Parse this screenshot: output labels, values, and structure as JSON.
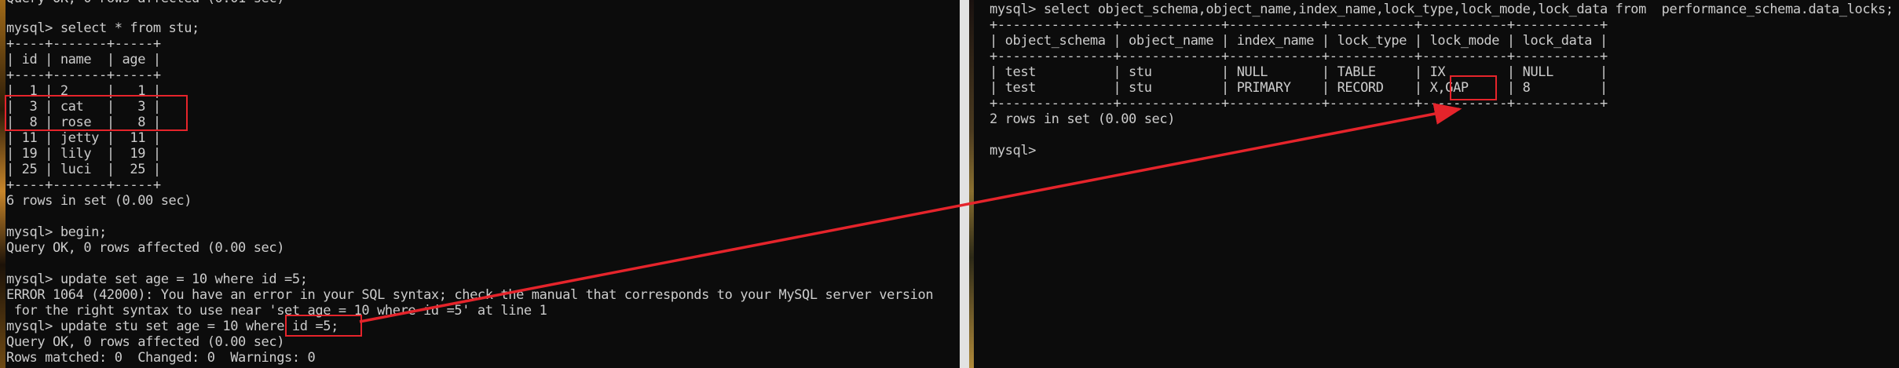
{
  "left_terminal": {
    "lines": [
      "Query OK, 0 rows affected (0.01 sec)",
      "",
      "mysql> select * from stu;",
      "+----+-------+-----+",
      "| id | name  | age |",
      "+----+-------+-----+",
      "|  1 | 2     |   1 |",
      "|  3 | cat   |   3 |",
      "|  8 | rose  |   8 |",
      "| 11 | jetty |  11 |",
      "| 19 | lily  |  19 |",
      "| 25 | luci  |  25 |",
      "+----+-------+-----+",
      "6 rows in set (0.00 sec)",
      "",
      "mysql> begin;",
      "Query OK, 0 rows affected (0.00 sec)",
      "",
      "mysql> update set age = 10 where id =5;",
      "ERROR 1064 (42000): You have an error in your SQL syntax; check the manual that corresponds to your MySQL server version",
      " for the right syntax to use near 'set age = 10 where id =5' at line 1",
      "mysql> update stu set age = 10 where id =5;",
      "Query OK, 0 rows affected (0.00 sec)",
      "Rows matched: 0  Changed: 0  Warnings: 0"
    ]
  },
  "right_terminal": {
    "lines": [
      "mysql> select object_schema,object_name,index_name,lock_type,lock_mode,lock_data from  performance_schema.data_locks;",
      "+---------------+-------------+------------+-----------+-----------+-----------+",
      "| object_schema | object_name | index_name | lock_type | lock_mode | lock_data |",
      "+---------------+-------------+------------+-----------+-----------+-----------+",
      "| test          | stu         | NULL       | TABLE     | IX        | NULL      |",
      "| test          | stu         | PRIMARY    | RECORD    | X,GAP     | 8         |",
      "+---------------+-------------+------------+-----------+-----------+-----------+",
      "2 rows in set (0.00 sec)",
      "",
      "mysql>"
    ]
  },
  "colors": {
    "terminal_bg": "#0c0c0c",
    "terminal_text": "#cccccc",
    "annotation_red": "#e5242b"
  }
}
